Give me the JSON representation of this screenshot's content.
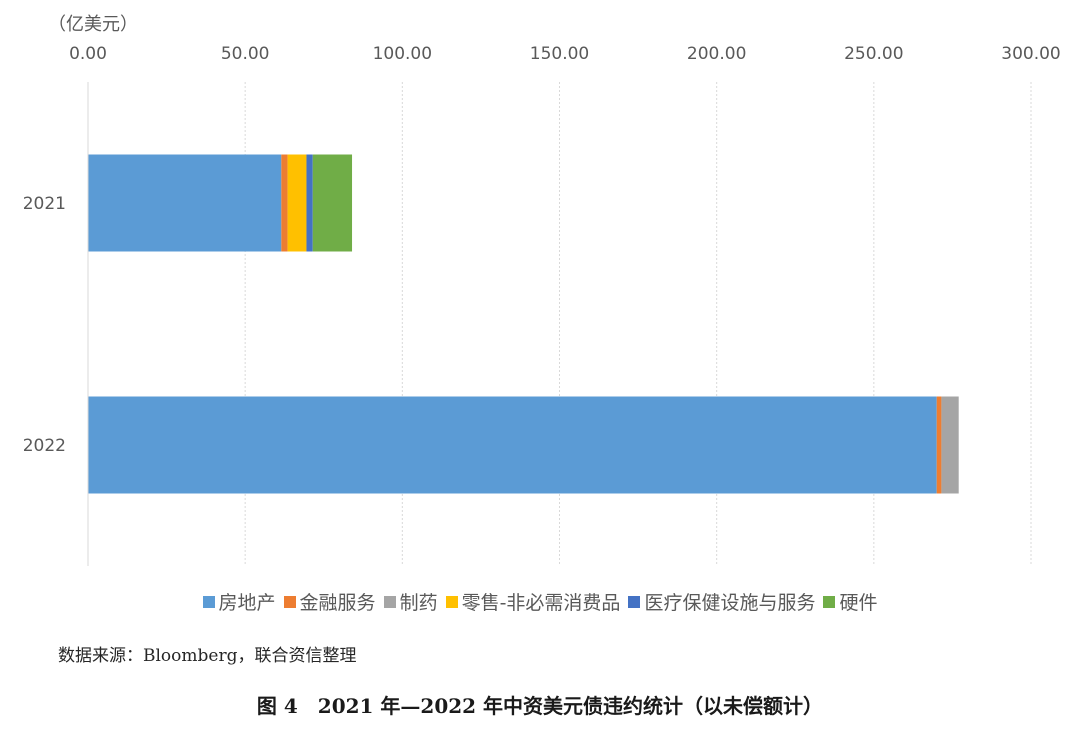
{
  "chart_data": {
    "type": "bar",
    "orientation": "horizontal",
    "stacked": true,
    "unit_label": "（亿美元）",
    "categories": [
      "2021",
      "2022"
    ],
    "xlim": [
      0,
      300
    ],
    "x_ticks": [
      "0.00",
      "50.00",
      "100.00",
      "150.00",
      "200.00",
      "250.00",
      "300.00"
    ],
    "x_axis_position": "top",
    "grid": "vertical dotted",
    "legend_position": "bottom",
    "series": [
      {
        "name": "房地产",
        "color": "#5B9BD5",
        "values": [
          61.5,
          270.0
        ]
      },
      {
        "name": "金融服务",
        "color": "#ED7D31",
        "values": [
          2.0,
          1.5
        ]
      },
      {
        "name": "制药",
        "color": "#A5A5A5",
        "values": [
          0,
          5.5
        ]
      },
      {
        "name": "零售-非必需消费品",
        "color": "#FFC000",
        "values": [
          6.0,
          0
        ]
      },
      {
        "name": "医疗保健设施与服务",
        "color": "#4472C4",
        "values": [
          2.0,
          0
        ]
      },
      {
        "name": "硬件",
        "color": "#70AD47",
        "values": [
          12.5,
          0
        ]
      }
    ]
  },
  "source": "数据来源：Bloomberg，联合资信整理",
  "caption": "图 4　2021 年—2022 年中资美元债违约统计（以未偿额计）"
}
